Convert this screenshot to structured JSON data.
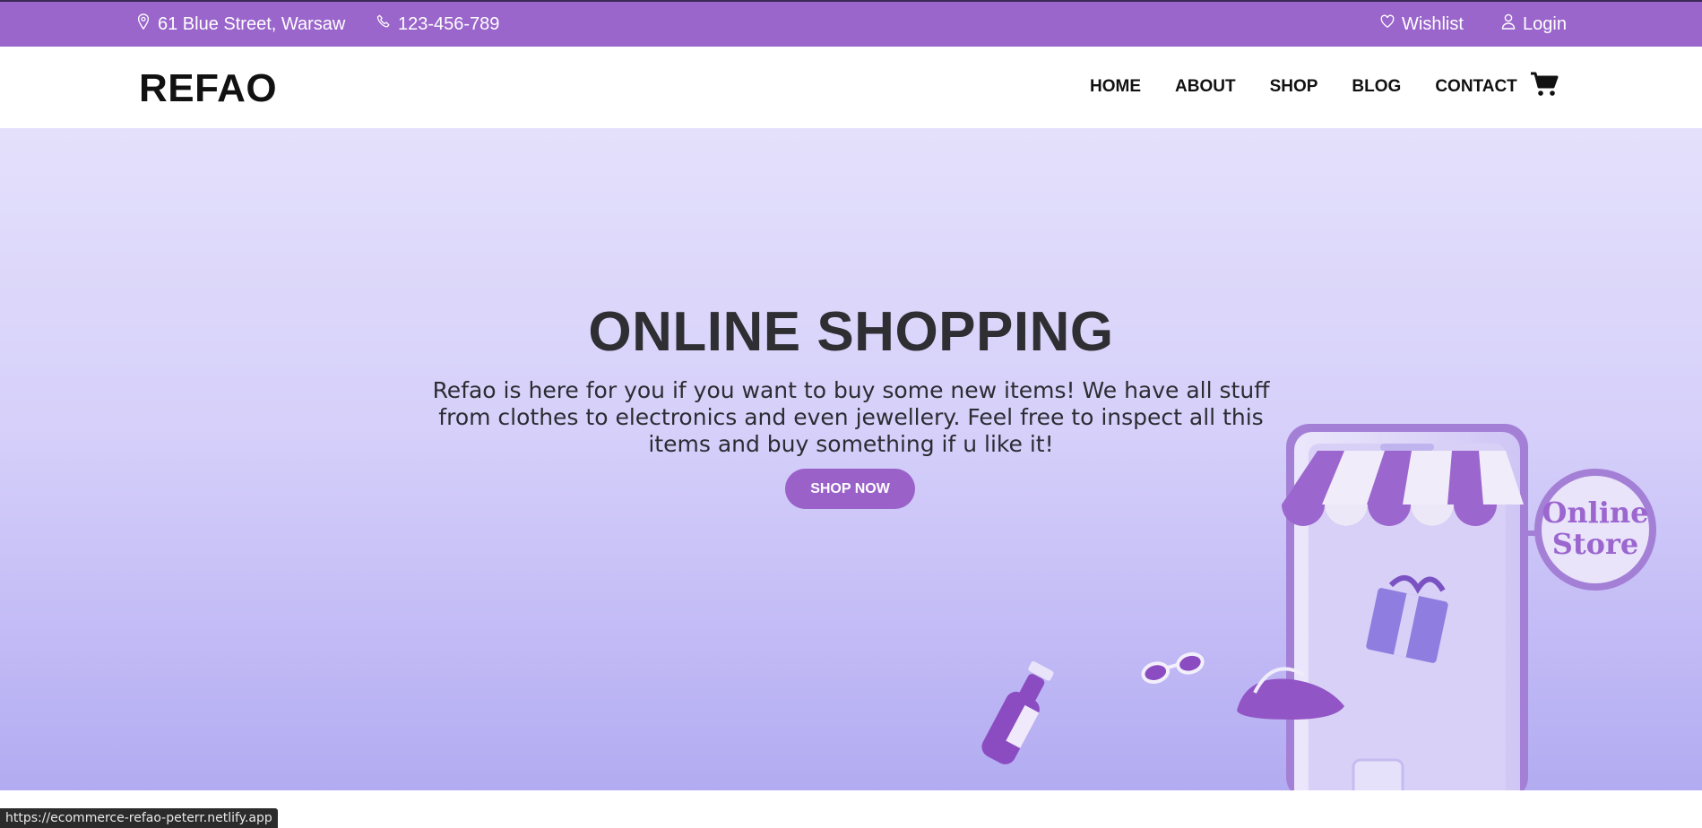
{
  "topbar": {
    "address": "61 Blue Street, Warsaw",
    "phone": "123-456-789",
    "wishlist": "Wishlist",
    "login": "Login",
    "icons": [
      "location-pin-icon",
      "phone-icon",
      "heart-icon",
      "user-icon"
    ]
  },
  "navbar": {
    "logo": "REFAO",
    "links": [
      "HOME",
      "ABOUT",
      "SHOP",
      "BLOG",
      "CONTACT"
    ],
    "cart_icon": "shopping-cart-icon"
  },
  "hero": {
    "title": "ONLINE SHOPPING",
    "text": "Refao is here for you if you want to buy some new items! We have all stuff from clothes to electronics and even jewellery. Feel free to inspect all this items and buy something if u like it!",
    "button": "SHOP NOW",
    "sign_line1": "Online",
    "sign_line2": "Store"
  },
  "status": {
    "url": "https://ecommerce-refao-peterr.netlify.app"
  },
  "colors": {
    "accent": "#9a66cb",
    "hero_top": "#e4e0fb",
    "hero_bottom": "#b2abf1",
    "text_dark": "#2e2e33"
  }
}
